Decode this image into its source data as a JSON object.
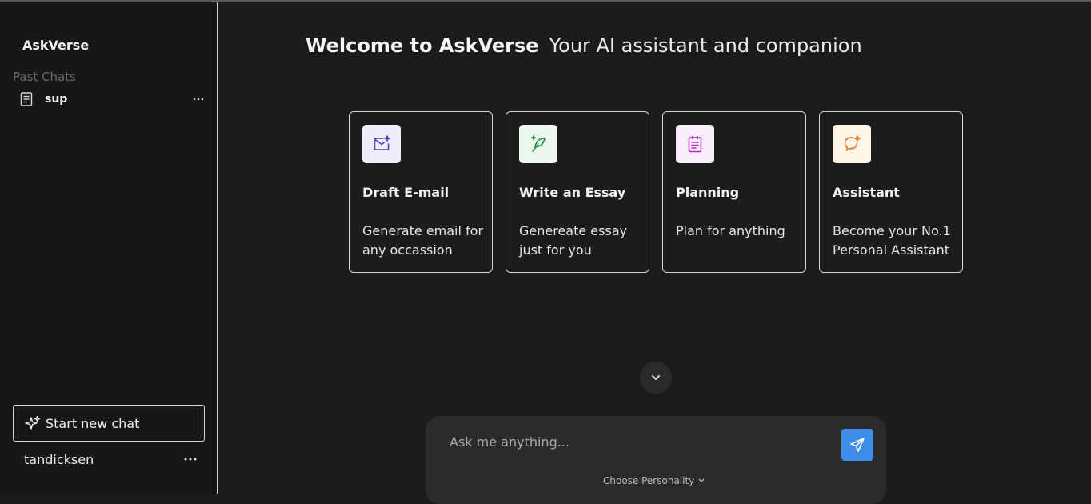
{
  "app": {
    "name": "AskVerse"
  },
  "sidebar": {
    "past_chats_label": "Past Chats",
    "chats": [
      {
        "title": "sup",
        "icon": "document-icon"
      }
    ],
    "new_chat_label": "Start new chat",
    "user": {
      "name": "tandicksen"
    }
  },
  "main": {
    "welcome_bold": "Welcome to AskVerse",
    "welcome_sub": "Your AI assistant and companion",
    "cards": [
      {
        "title": "Draft E-mail",
        "description": "Generate email for any occassion",
        "icon": "mail-sparkle-icon",
        "icon_bg": "#eeeefb",
        "icon_color": "#4b48c8"
      },
      {
        "title": "Write an Essay",
        "description": "Genereate essay just for you",
        "icon": "feather-pen-icon",
        "icon_bg": "#ecf8ef",
        "icon_color": "#1e8a3e"
      },
      {
        "title": "Planning",
        "description": "Plan for anything",
        "icon": "clipboard-icon",
        "icon_bg": "#fbeefc",
        "icon_color": "#b626c6"
      },
      {
        "title": "Assistant",
        "description": "Become your No.1 Personal Assistant",
        "icon": "chat-sparkle-icon",
        "icon_bg": "#fdf6e6",
        "icon_color": "#e8702a"
      }
    ],
    "composer": {
      "placeholder": "Ask me anything...",
      "personality_label": "Choose Personality"
    }
  },
  "colors": {
    "accent": "#3d8ee8",
    "background": "#1c1c1c",
    "sidebar": "#171717"
  }
}
